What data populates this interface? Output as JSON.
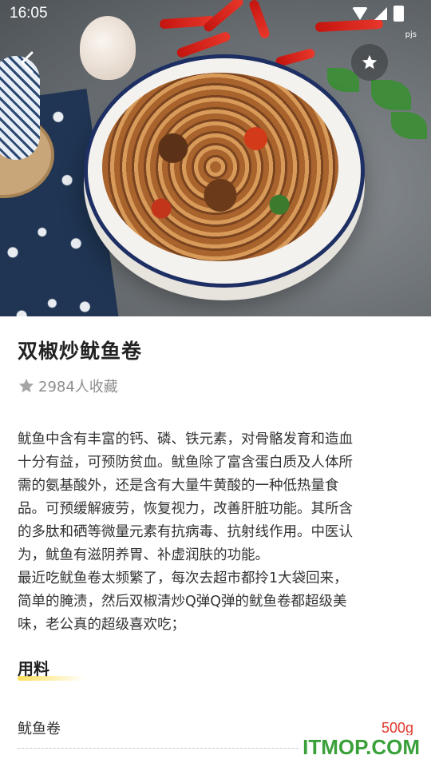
{
  "status_bar": {
    "time": "16:05",
    "corner_label": "pjs",
    "icons": [
      "wifi-icon",
      "signal-icon",
      "battery-icon"
    ]
  },
  "hero": {
    "image": "stir-fried-squid-rolls-photo",
    "back_icon": "chevron-left-icon",
    "favorite_icon": "star-icon"
  },
  "recipe": {
    "title": "双椒炒鱿鱼卷",
    "favorites_text": "2984人收藏",
    "description": "鱿鱼中含有丰富的钙、磷、铁元素，对骨骼发育和造血\n十分有益，可预防贫血。鱿鱼除了富含蛋白质及人体所\n需的氨基酸外，还是含有大量牛黄酸的一种低热量食\n品。可预缓解疲劳，恢复视力，改善肝脏功能。其所含\n的多肽和硒等微量元素有抗病毒、抗射线作用。中医认\n为，鱿鱼有滋阴养胃、补虚润肤的功能。\n最近吃鱿鱼卷太频繁了，每次去超市都拎1大袋回来，\n简单的腌渍，然后双椒清炒Q弹Q弹的鱿鱼卷都超级美\n味，老公真的超级喜欢吃；"
  },
  "ingredients": {
    "section_title": "用料",
    "items": [
      {
        "name": "鱿鱼卷",
        "amount": "500g"
      }
    ]
  },
  "watermark": "ITMOP.COM",
  "colors": {
    "accent_red": "#e0392b",
    "highlight_yellow": "#ffe05a",
    "watermark_green": "#3aa13a"
  }
}
